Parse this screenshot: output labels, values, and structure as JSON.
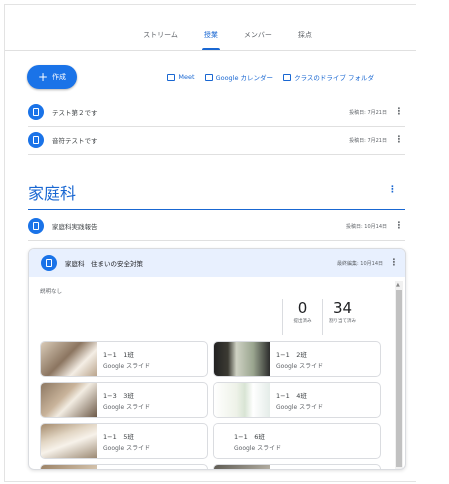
{
  "nav": {
    "tabs": [
      "ストリーム",
      "授業",
      "メンバー",
      "採点"
    ],
    "active": "授業"
  },
  "actions": {
    "create_label": "作成",
    "meet_label": "Meet",
    "calendar_label": "Google カレンダー",
    "drive_label": "クラスのドライブ フォルダ"
  },
  "posts": [
    {
      "title": "テスト第２です",
      "date": "投稿日: 7月21日"
    },
    {
      "title": "音符テストです",
      "date": "投稿日: 7月21日"
    }
  ],
  "topic": {
    "title": "家庭科"
  },
  "topic_posts": [
    {
      "title": "家庭科実践報告",
      "date": "投稿日: 10月14日"
    }
  ],
  "card": {
    "title": "家庭科　住まいの安全対策",
    "date": "最終編集: 10月14日",
    "description": "説明なし",
    "stats": [
      {
        "value": "0",
        "caption": "提出済み"
      },
      {
        "value": "34",
        "caption": "割り当て済み"
      }
    ],
    "attachments": [
      {
        "name": "1−1　1班",
        "type": "Google スライド"
      },
      {
        "name": "1−1　2班",
        "type": "Google スライド"
      },
      {
        "name": "1−3　3班",
        "type": "Google スライド"
      },
      {
        "name": "1−1　4班",
        "type": "Google スライド"
      },
      {
        "name": "1−1　5班",
        "type": "Google スライド"
      },
      {
        "name": "1−1　6班",
        "type": "Google スライド"
      }
    ]
  },
  "colors": {
    "accent": "#1a73e8",
    "link": "#1967d2",
    "card_header": "#e8f0fe"
  }
}
